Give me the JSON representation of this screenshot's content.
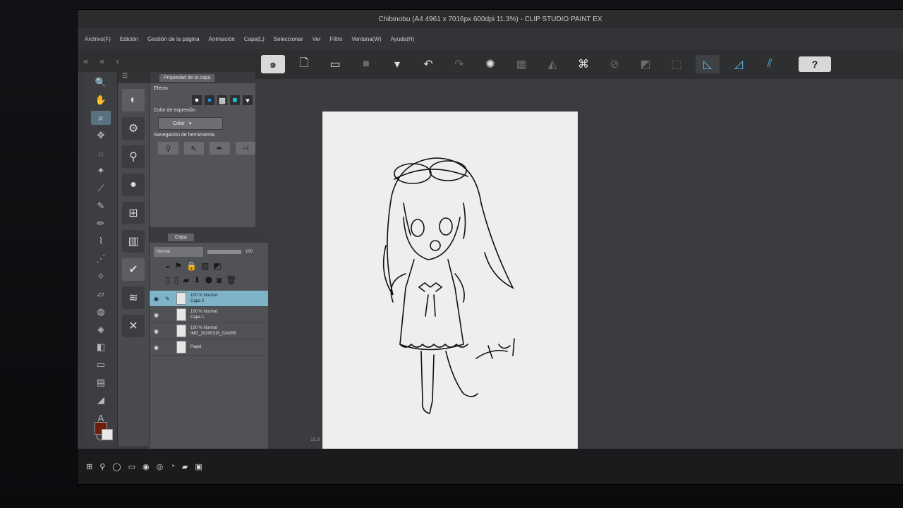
{
  "window": {
    "title": "Chibinobu (A4 4961 x 7016px 600dpi 11.3%) - CLIP STUDIO PAINT EX"
  },
  "menu": [
    "Archivo(F)",
    "Edición",
    "Gestión de la página",
    "Animación",
    "Capa(L)",
    "Seleccionar",
    "Ver",
    "Filtro",
    "Ventana(W)",
    "Ayuda(H)"
  ],
  "toolbar": {
    "help_label": "?"
  },
  "property_panel": {
    "tab": "Propiedad de la capa",
    "effect_label": "Efecto",
    "expression_label": "Color de expresión",
    "expression_value": "Color",
    "navigation_label": "Navegación de herramienta"
  },
  "layer_panel": {
    "tab": "Capa",
    "blend_mode": "Normal",
    "opacity": "100",
    "layers": [
      {
        "title": "100 % Normal",
        "name": "Capa 2",
        "selected": true
      },
      {
        "title": "100 % Normal",
        "name": "Capa 1",
        "selected": false
      },
      {
        "title": "100 % Normal",
        "name": "IMG_20200319_024255",
        "selected": false
      },
      {
        "title": "",
        "name": "Papel",
        "selected": false
      }
    ]
  },
  "status": {
    "zoom": "11.3"
  },
  "colors": {
    "main": "#6b1e0e",
    "sub": "#e8e8e8",
    "selection": "#7fb3c7"
  }
}
